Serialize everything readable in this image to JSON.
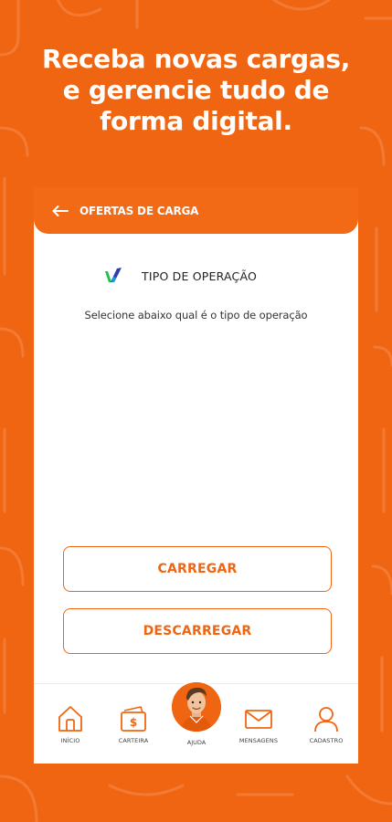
{
  "promo": {
    "line1": "Receba novas cargas,",
    "line2": "e gerencie tudo de",
    "line3": "forma digital."
  },
  "appbar": {
    "title": "OFERTAS DE CARGA",
    "back_icon": "arrow-left-icon"
  },
  "operation": {
    "logo_icon": "brand-logo-icon",
    "title": "TIPO DE OPERAÇÃO",
    "subtitle": "Selecione abaixo qual é o tipo de operação"
  },
  "buttons": {
    "load": "CARREGAR",
    "unload": "DESCARREGAR"
  },
  "nav": {
    "home": "INÍCIO",
    "wallet": "CARTEIRA",
    "help": "AJUDA",
    "messages": "MENSAGENS",
    "profile": "CADASTRO"
  },
  "colors": {
    "brand": "#f06511",
    "white": "#ffffff",
    "logo_green": "#1fbf4f",
    "logo_blue": "#2a3fb0"
  }
}
